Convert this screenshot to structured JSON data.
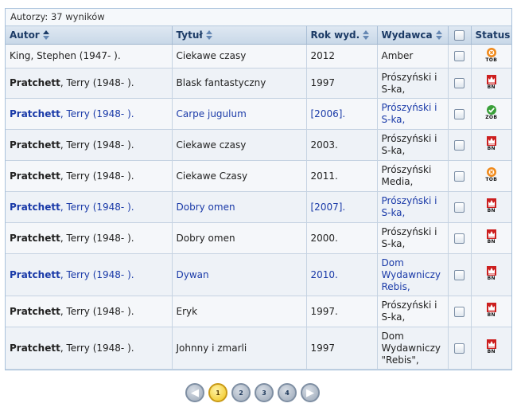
{
  "results_caption": "Autorzy: 37 wyników",
  "columns": {
    "author": "Autor",
    "title": "Tytuł",
    "year": "Rok wyd.",
    "publisher": "Wydawca",
    "status": "Status"
  },
  "rows": [
    {
      "surname": "King",
      "rest": ", Stephen (1947- ).",
      "title": "Ciekawe czasy",
      "year": "2012",
      "publisher": "Amber",
      "status_label": "TOB",
      "status_icon": "tob-orange-circle-icon",
      "linked": false,
      "bold": false
    },
    {
      "surname": "Pratchett",
      "rest": ", Terry (1948- ).",
      "title": "Blask fantastyczny",
      "year": "1997",
      "publisher": "Prószyński i S-ka,",
      "status_label": "BN",
      "status_icon": "bn-red-crown-icon",
      "linked": false,
      "bold": true
    },
    {
      "surname": "Pratchett",
      "rest": ", Terry (1948- ).",
      "title": "Carpe jugulum",
      "year": "[2006].",
      "publisher": "Prószyński i S-ka,",
      "status_label": "ZOB",
      "status_icon": "zob-green-check-icon",
      "linked": true,
      "bold": true
    },
    {
      "surname": "Pratchett",
      "rest": ", Terry (1948- ).",
      "title": "Ciekawe czasy",
      "year": "2003.",
      "publisher": "Prószyński i S-ka,",
      "status_label": "BN",
      "status_icon": "bn-red-crown-icon",
      "linked": false,
      "bold": true
    },
    {
      "surname": "Pratchett",
      "rest": ", Terry (1948- ).",
      "title": "Ciekawe Czasy",
      "year": "2011.",
      "publisher": "Prószyński Media,",
      "status_label": "TOB",
      "status_icon": "tob-orange-circle-icon",
      "linked": false,
      "bold": true
    },
    {
      "surname": "Pratchett",
      "rest": ", Terry (1948- ).",
      "title": "Dobry omen",
      "year": "[2007].",
      "publisher": "Prószyński i S-ka,",
      "status_label": "BN",
      "status_icon": "bn-red-crown-icon",
      "linked": true,
      "bold": true
    },
    {
      "surname": "Pratchett",
      "rest": ", Terry (1948- ).",
      "title": "Dobry omen",
      "year": "2000.",
      "publisher": "Prószyński i S-ka,",
      "status_label": "BN",
      "status_icon": "bn-red-crown-icon",
      "linked": false,
      "bold": true
    },
    {
      "surname": "Pratchett",
      "rest": ", Terry (1948- ).",
      "title": "Dywan",
      "year": "2010.",
      "publisher": "Dom Wydawniczy Rebis,",
      "status_label": "BN",
      "status_icon": "bn-red-crown-icon",
      "linked": true,
      "bold": true
    },
    {
      "surname": "Pratchett",
      "rest": ", Terry (1948- ).",
      "title": "Eryk",
      "year": "1997.",
      "publisher": "Prószyński i S-ka,",
      "status_label": "BN",
      "status_icon": "bn-red-crown-icon",
      "linked": false,
      "bold": true
    },
    {
      "surname": "Pratchett",
      "rest": ", Terry (1948- ).",
      "title": "Johnny i zmarli",
      "year": "1997",
      "publisher": "Dom Wydawniczy \"Rebis\",",
      "status_label": "BN",
      "status_icon": "bn-red-crown-icon",
      "linked": false,
      "bold": true
    }
  ],
  "pager": {
    "prev_icon": "arrow-left-icon",
    "next_icon": "arrow-right-icon",
    "pages": [
      "1",
      "2",
      "3",
      "4"
    ],
    "current": "1"
  },
  "colors": {
    "header_text": "#1c3b66",
    "link": "#1a3aa8",
    "bn_red": "#cc1f1f",
    "tob_orange": "#f08a1c",
    "zob_green": "#3aa03a",
    "pager_active": "#f0c419"
  }
}
